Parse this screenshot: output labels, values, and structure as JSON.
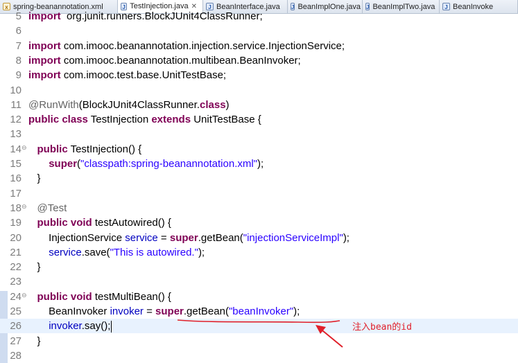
{
  "tabs": [
    {
      "label": "spring-beanannotation.xml",
      "icon": "xml-file-icon",
      "active": false
    },
    {
      "label": "TestInjection.java",
      "icon": "java-file-icon",
      "active": true
    },
    {
      "label": "BeanInterface.java",
      "icon": "java-file-icon",
      "active": false
    },
    {
      "label": "BeanImplOne.java",
      "icon": "java-file-icon",
      "active": false
    },
    {
      "label": "BeanImplTwo.java",
      "icon": "java-file-icon",
      "active": false
    },
    {
      "label": "BeanInvoke",
      "icon": "java-file-icon",
      "active": false
    }
  ],
  "editor": {
    "lines": [
      {
        "num": "5",
        "parts": [
          [
            "kw",
            "import"
          ],
          [
            "",
            "  org.junit.runners.BlockJUnit4ClassRunner;"
          ]
        ]
      },
      {
        "num": "6",
        "parts": []
      },
      {
        "num": "7",
        "parts": [
          [
            "kw",
            "import"
          ],
          [
            "",
            " com.imooc.beanannotation.injection.service.InjectionService;"
          ]
        ]
      },
      {
        "num": "8",
        "parts": [
          [
            "kw",
            "import"
          ],
          [
            "",
            " com.imooc.beanannotation.multibean.BeanInvoker;"
          ]
        ]
      },
      {
        "num": "9",
        "parts": [
          [
            "kw",
            "import"
          ],
          [
            "",
            " com.imooc.test.base.UnitTestBase;"
          ]
        ]
      },
      {
        "num": "10",
        "parts": []
      },
      {
        "num": "11",
        "parts": [
          [
            "an",
            "@RunWith"
          ],
          [
            "",
            "(BlockJUnit4ClassRunner."
          ],
          [
            "kw",
            "class"
          ],
          [
            "",
            ")"
          ]
        ]
      },
      {
        "num": "12",
        "parts": [
          [
            "kw",
            "public"
          ],
          [
            "",
            " "
          ],
          [
            "kw",
            "class"
          ],
          [
            "",
            " TestInjection "
          ],
          [
            "kw",
            "extends"
          ],
          [
            "",
            " UnitTestBase {"
          ]
        ]
      },
      {
        "num": "13",
        "parts": []
      },
      {
        "num": "14",
        "fold": "⊖",
        "parts": [
          [
            "",
            "   "
          ],
          [
            "kw",
            "public"
          ],
          [
            "",
            " TestInjection() {"
          ]
        ]
      },
      {
        "num": "15",
        "parts": [
          [
            "",
            "       "
          ],
          [
            "kw",
            "super"
          ],
          [
            "",
            "("
          ],
          [
            "st",
            "\"classpath:spring-beanannotation.xml\""
          ],
          [
            "",
            ");"
          ]
        ]
      },
      {
        "num": "16",
        "parts": [
          [
            "",
            "   }"
          ]
        ]
      },
      {
        "num": "17",
        "parts": []
      },
      {
        "num": "18",
        "fold": "⊖",
        "parts": [
          [
            "",
            "   "
          ],
          [
            "an",
            "@Test"
          ]
        ]
      },
      {
        "num": "19",
        "parts": [
          [
            "",
            "   "
          ],
          [
            "kw",
            "public"
          ],
          [
            "",
            " "
          ],
          [
            "kw",
            "void"
          ],
          [
            "",
            " testAutowired() {"
          ]
        ]
      },
      {
        "num": "20",
        "parts": [
          [
            "",
            "       InjectionService "
          ],
          [
            "fd",
            "service"
          ],
          [
            "",
            " = "
          ],
          [
            "kw",
            "super"
          ],
          [
            "",
            ".getBean("
          ],
          [
            "st",
            "\"injectionServiceImpl\""
          ],
          [
            "",
            ");"
          ]
        ]
      },
      {
        "num": "21",
        "parts": [
          [
            "",
            "       "
          ],
          [
            "fd",
            "service"
          ],
          [
            "",
            ".save("
          ],
          [
            "st",
            "\"This is autowired.\""
          ],
          [
            "",
            ");"
          ]
        ]
      },
      {
        "num": "22",
        "parts": [
          [
            "",
            "   }"
          ]
        ]
      },
      {
        "num": "23",
        "parts": []
      },
      {
        "num": "24",
        "fold": "⊖",
        "parts": [
          [
            "",
            "   "
          ],
          [
            "kw",
            "public"
          ],
          [
            "",
            " "
          ],
          [
            "kw",
            "void"
          ],
          [
            "",
            " testMultiBean() {"
          ]
        ]
      },
      {
        "num": "25",
        "parts": [
          [
            "",
            "       BeanInvoker "
          ],
          [
            "fd",
            "invoker"
          ],
          [
            "",
            " = "
          ],
          [
            "kw",
            "super"
          ],
          [
            "",
            ".getBean("
          ],
          [
            "st",
            "\"beanInvoker\""
          ],
          [
            "",
            ");"
          ]
        ]
      },
      {
        "num": "26",
        "current": true,
        "parts": [
          [
            "",
            "       "
          ],
          [
            "fd",
            "invoker"
          ],
          [
            "",
            ".say();"
          ]
        ]
      },
      {
        "num": "27",
        "parts": [
          [
            "",
            "   }"
          ]
        ]
      },
      {
        "num": "28",
        "parts": []
      }
    ]
  },
  "annotation": {
    "note_text": "注入bean的id",
    "color": "#e0202a"
  },
  "colors": {
    "keyword": "#7f0055",
    "annotation": "#646464",
    "string": "#2a00ff",
    "field": "#0000c0",
    "current_line": "#e8f2fe"
  }
}
